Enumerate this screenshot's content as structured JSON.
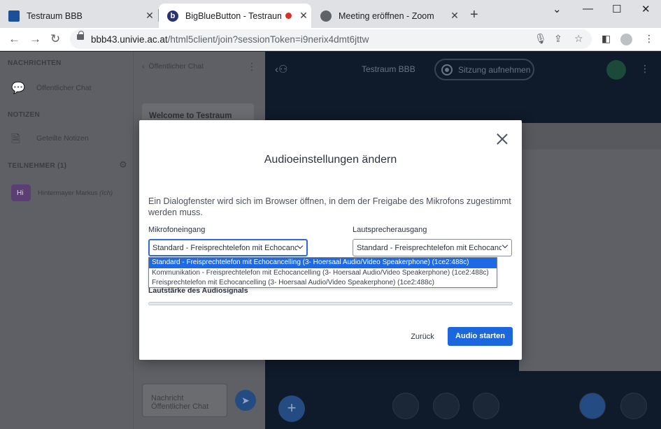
{
  "browser": {
    "tabs": [
      {
        "title": "Testraum BBB",
        "icon": "univie-logo-icon"
      },
      {
        "title": "BigBlueButton - Testraum BB",
        "icon": "bbb-logo-icon",
        "recording": true
      },
      {
        "title": "Meeting eröffnen - Zoom",
        "icon": "globe-icon"
      }
    ],
    "new_tab": "+",
    "url_host": "bbb43.univie.ac.at",
    "url_path": "/html5client/join?sessionToken=i9nerix4dmt6jttw"
  },
  "sidebar": {
    "messages_title": "NACHRICHTEN",
    "public_chat": "Öffentlicher Chat",
    "notes_title": "NOTIZEN",
    "shared_notes": "Geteilte Notizen",
    "participants_title": "TEILNEHMER (1)",
    "user_initials": "Hi",
    "user_name": "Hintermayer Markus",
    "user_suffix": "(Ich)"
  },
  "chat": {
    "header": "Öffentlicher Chat",
    "welcome": "Welcome to Testraum",
    "input_line1": "Nachricht",
    "input_line2": "Öffentlicher Chat"
  },
  "main": {
    "title": "Testraum BBB",
    "record_label": "Sitzung aufnehmen"
  },
  "modal": {
    "title": "Audioeinstellungen ändern",
    "description": "Ein Dialogfenster wird sich im Browser öffnen, in dem der Freigabe des Mikrofons zugestimmt werden muss.",
    "mic_label": "Mikrofoneingang",
    "mic_value": "Standard - Freisprechtelefon mit Echocancel",
    "speaker_label": "Lautsprecherausgang",
    "speaker_value": "Standard - Freisprechtelefon mit Echocancel",
    "volume_label": "Lautstärke des Audiosignals",
    "back_button": "Zurück",
    "start_button": "Audio starten"
  },
  "mic_options": [
    "Standard - Freisprechtelefon mit Echocancelling (3- Hoersaal Audio/Video Speakerphone) (1ce2:488c)",
    "Kommunikation - Freisprechtelefon mit Echocancelling (3- Hoersaal Audio/Video Speakerphone) (1ce2:488c)",
    "Freisprechtelefon mit Echocancelling (3- Hoersaal Audio/Video Speakerphone) (1ce2:488c)"
  ],
  "colors": {
    "accent": "#1b67dd",
    "selected_option": "#1e6ae6"
  }
}
